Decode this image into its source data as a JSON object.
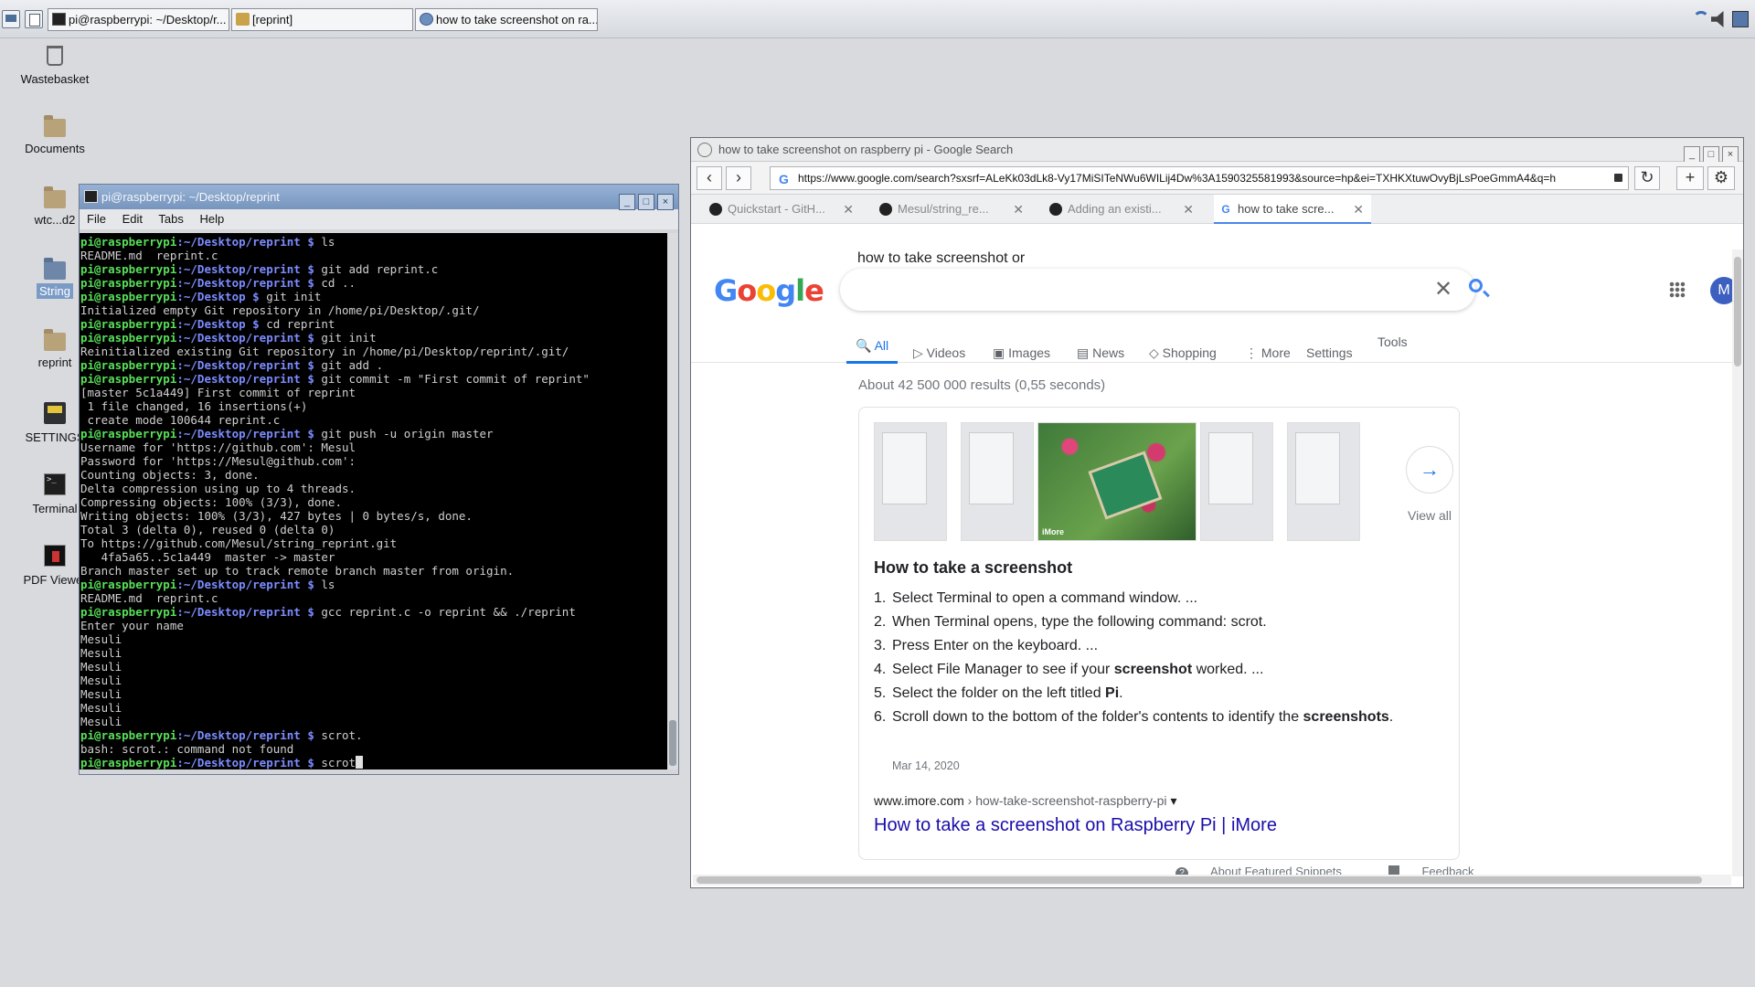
{
  "taskbar": {
    "tasks": [
      {
        "label": "pi@raspberrypi: ~/Desktop/r..."
      },
      {
        "label": "[reprint]"
      },
      {
        "label": "how to take screenshot on ra..."
      }
    ]
  },
  "desktop": {
    "icons": [
      {
        "label": "Wastebasket"
      },
      {
        "label": "Documents"
      },
      {
        "label": "wtc...d2"
      },
      {
        "label": "String"
      },
      {
        "label": "reprint"
      },
      {
        "label": "SETTINGS"
      },
      {
        "label": "Terminal"
      },
      {
        "label": "PDF Viewer"
      }
    ]
  },
  "terminal": {
    "title": "pi@raspberrypi: ~/Desktop/reprint",
    "menu": [
      "File",
      "Edit",
      "Tabs",
      "Help"
    ],
    "lines": [
      {
        "u": "pi@raspberrypi",
        "p": ":~/Desktop/reprint $",
        "t": " ls"
      },
      {
        "t": "README.md  reprint.c"
      },
      {
        "u": "pi@raspberrypi",
        "p": ":~/Desktop/reprint $",
        "t": " git add reprint.c"
      },
      {
        "u": "pi@raspberrypi",
        "p": ":~/Desktop/reprint $",
        "t": " cd .."
      },
      {
        "u": "pi@raspberrypi",
        "p": ":~/Desktop $",
        "t": " git init"
      },
      {
        "t": "Initialized empty Git repository in /home/pi/Desktop/.git/"
      },
      {
        "u": "pi@raspberrypi",
        "p": ":~/Desktop $",
        "t": " cd reprint"
      },
      {
        "u": "pi@raspberrypi",
        "p": ":~/Desktop/reprint $",
        "t": " git init"
      },
      {
        "t": "Reinitialized existing Git repository in /home/pi/Desktop/reprint/.git/"
      },
      {
        "u": "pi@raspberrypi",
        "p": ":~/Desktop/reprint $",
        "t": " git add ."
      },
      {
        "u": "pi@raspberrypi",
        "p": ":~/Desktop/reprint $",
        "t": " git commit -m \"First commit of reprint\""
      },
      {
        "t": "[master 5c1a449] First commit of reprint"
      },
      {
        "t": " 1 file changed, 16 insertions(+)"
      },
      {
        "t": " create mode 100644 reprint.c"
      },
      {
        "u": "pi@raspberrypi",
        "p": ":~/Desktop/reprint $",
        "t": " git push -u origin master"
      },
      {
        "t": "Username for 'https://github.com': Mesul"
      },
      {
        "t": "Password for 'https://Mesul@github.com':"
      },
      {
        "t": "Counting objects: 3, done."
      },
      {
        "t": "Delta compression using up to 4 threads."
      },
      {
        "t": "Compressing objects: 100% (3/3), done."
      },
      {
        "t": "Writing objects: 100% (3/3), 427 bytes | 0 bytes/s, done."
      },
      {
        "t": "Total 3 (delta 0), reused 0 (delta 0)"
      },
      {
        "t": "To https://github.com/Mesul/string_reprint.git"
      },
      {
        "t": "   4fa5a65..5c1a449  master -> master"
      },
      {
        "t": "Branch master set up to track remote branch master from origin."
      },
      {
        "u": "pi@raspberrypi",
        "p": ":~/Desktop/reprint $",
        "t": " ls"
      },
      {
        "t": "README.md  reprint.c"
      },
      {
        "u": "pi@raspberrypi",
        "p": ":~/Desktop/reprint $",
        "t": " gcc reprint.c -o reprint && ./reprint"
      },
      {
        "t": "Enter your name"
      },
      {
        "t": "Mesuli"
      },
      {
        "t": "Mesuli"
      },
      {
        "t": "Mesuli"
      },
      {
        "t": "Mesuli"
      },
      {
        "t": "Mesuli"
      },
      {
        "t": "Mesuli"
      },
      {
        "t": "Mesuli"
      },
      {
        "u": "pi@raspberrypi",
        "p": ":~/Desktop/reprint $",
        "t": " scrot."
      },
      {
        "t": "bash: scrot.: command not found"
      },
      {
        "u": "pi@raspberrypi",
        "p": ":~/Desktop/reprint $",
        "t": " scrot",
        "cursor": true
      }
    ]
  },
  "browser": {
    "title": "how to take screenshot on raspberry pi - Google Search",
    "url": "https://www.google.com/search?sxsrf=ALeKk03dLk8-Vy17MiSITeNWu6WILij4Dw%3A1590325581993&source=hp&ei=TXHKXtuwOvyBjLsPoeGmmA4&q=h",
    "tabs": [
      {
        "label": "Quickstart - GitH..."
      },
      {
        "label": "Mesul/string_re..."
      },
      {
        "label": "Adding an existi..."
      },
      {
        "label": "how to take scre..."
      }
    ],
    "google": {
      "logo": "Google",
      "query": "how to take screenshot or",
      "nav": {
        "all": "All",
        "videos": "Videos",
        "images": "Images",
        "news": "News",
        "shopping": "Shopping",
        "more": "More",
        "settings": "Settings",
        "tools": "Tools"
      },
      "avatar": "M",
      "stats": "About 42 500 000 results (0,55 seconds)",
      "image_tag": "iMore",
      "view_all": "View all",
      "snippet_title": "How to take a screenshot",
      "steps": [
        {
          "n": "1.",
          "text": "Select Terminal to open a command window. ..."
        },
        {
          "n": "2.",
          "text": "When Terminal opens, type the following command: scrot."
        },
        {
          "n": "3.",
          "text": "Press Enter on the keyboard. ..."
        },
        {
          "n": "4.",
          "pre": "Select File Manager to see if your ",
          "bold": "screenshot",
          "post": " worked. ..."
        },
        {
          "n": "5.",
          "pre": "Select the folder on the left titled ",
          "bold": "Pi",
          "post": "."
        },
        {
          "n": "6.",
          "pre": "Scroll down to the bottom of the folder's contents to identify the ",
          "bold": "screenshots",
          "post": "."
        }
      ],
      "date": "Mar 14, 2020",
      "site": "www.imore.com",
      "site_path": " › how-take-screenshot-raspberry-pi",
      "link": "How to take a screenshot on Raspberry Pi | iMore",
      "about": "About Featured Snippets",
      "feedback": "Feedback"
    }
  }
}
